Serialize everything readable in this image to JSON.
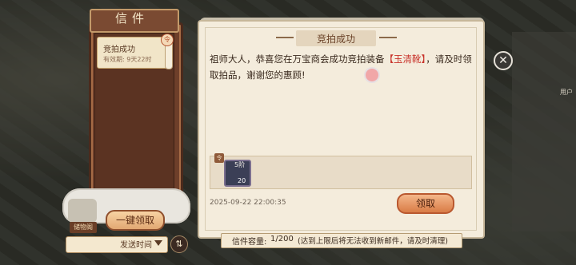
{
  "mail_list": {
    "title": "信件",
    "items": [
      {
        "subject": "竞拍成功",
        "expiry": "有效期: 9天22时"
      }
    ],
    "badge": "令",
    "one_click_claim": "一键领取",
    "gift_label": "储物阁",
    "sort_label": "发送时间",
    "sort_toggle_icon": "⇅"
  },
  "mail_detail": {
    "title": "竞拍成功",
    "body_prefix": "祖师大人，恭喜您在万宝商会成功竞拍装备",
    "item_name": "【玉清靴】",
    "body_suffix": "，请及时领取拍品，谢谢您的惠顾!",
    "attachment": {
      "level": "5阶",
      "count": "20",
      "badge": "令"
    },
    "timestamp": "2025-09-22 22:00:35",
    "claim_button": "领取"
  },
  "capacity": {
    "label": "信件容量:",
    "count": "1/200",
    "note": "(达到上限后将无法收到新邮件，请及时清理)"
  },
  "side_label": "用户",
  "close_icon": "✕"
}
